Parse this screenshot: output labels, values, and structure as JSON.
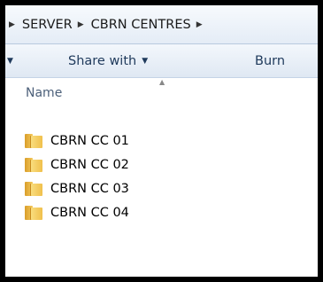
{
  "breadcrumb": {
    "items": [
      "SERVER",
      "CBRN CENTRES"
    ]
  },
  "toolbar": {
    "share_with": "Share with",
    "burn": "Burn"
  },
  "list": {
    "column_name": "Name",
    "files": [
      {
        "name": "CBRN CC 01",
        "icon": "folder-icon"
      },
      {
        "name": "CBRN CC 02",
        "icon": "folder-icon"
      },
      {
        "name": "CBRN CC 03",
        "icon": "folder-icon"
      },
      {
        "name": "CBRN CC 04",
        "icon": "folder-icon"
      }
    ]
  }
}
